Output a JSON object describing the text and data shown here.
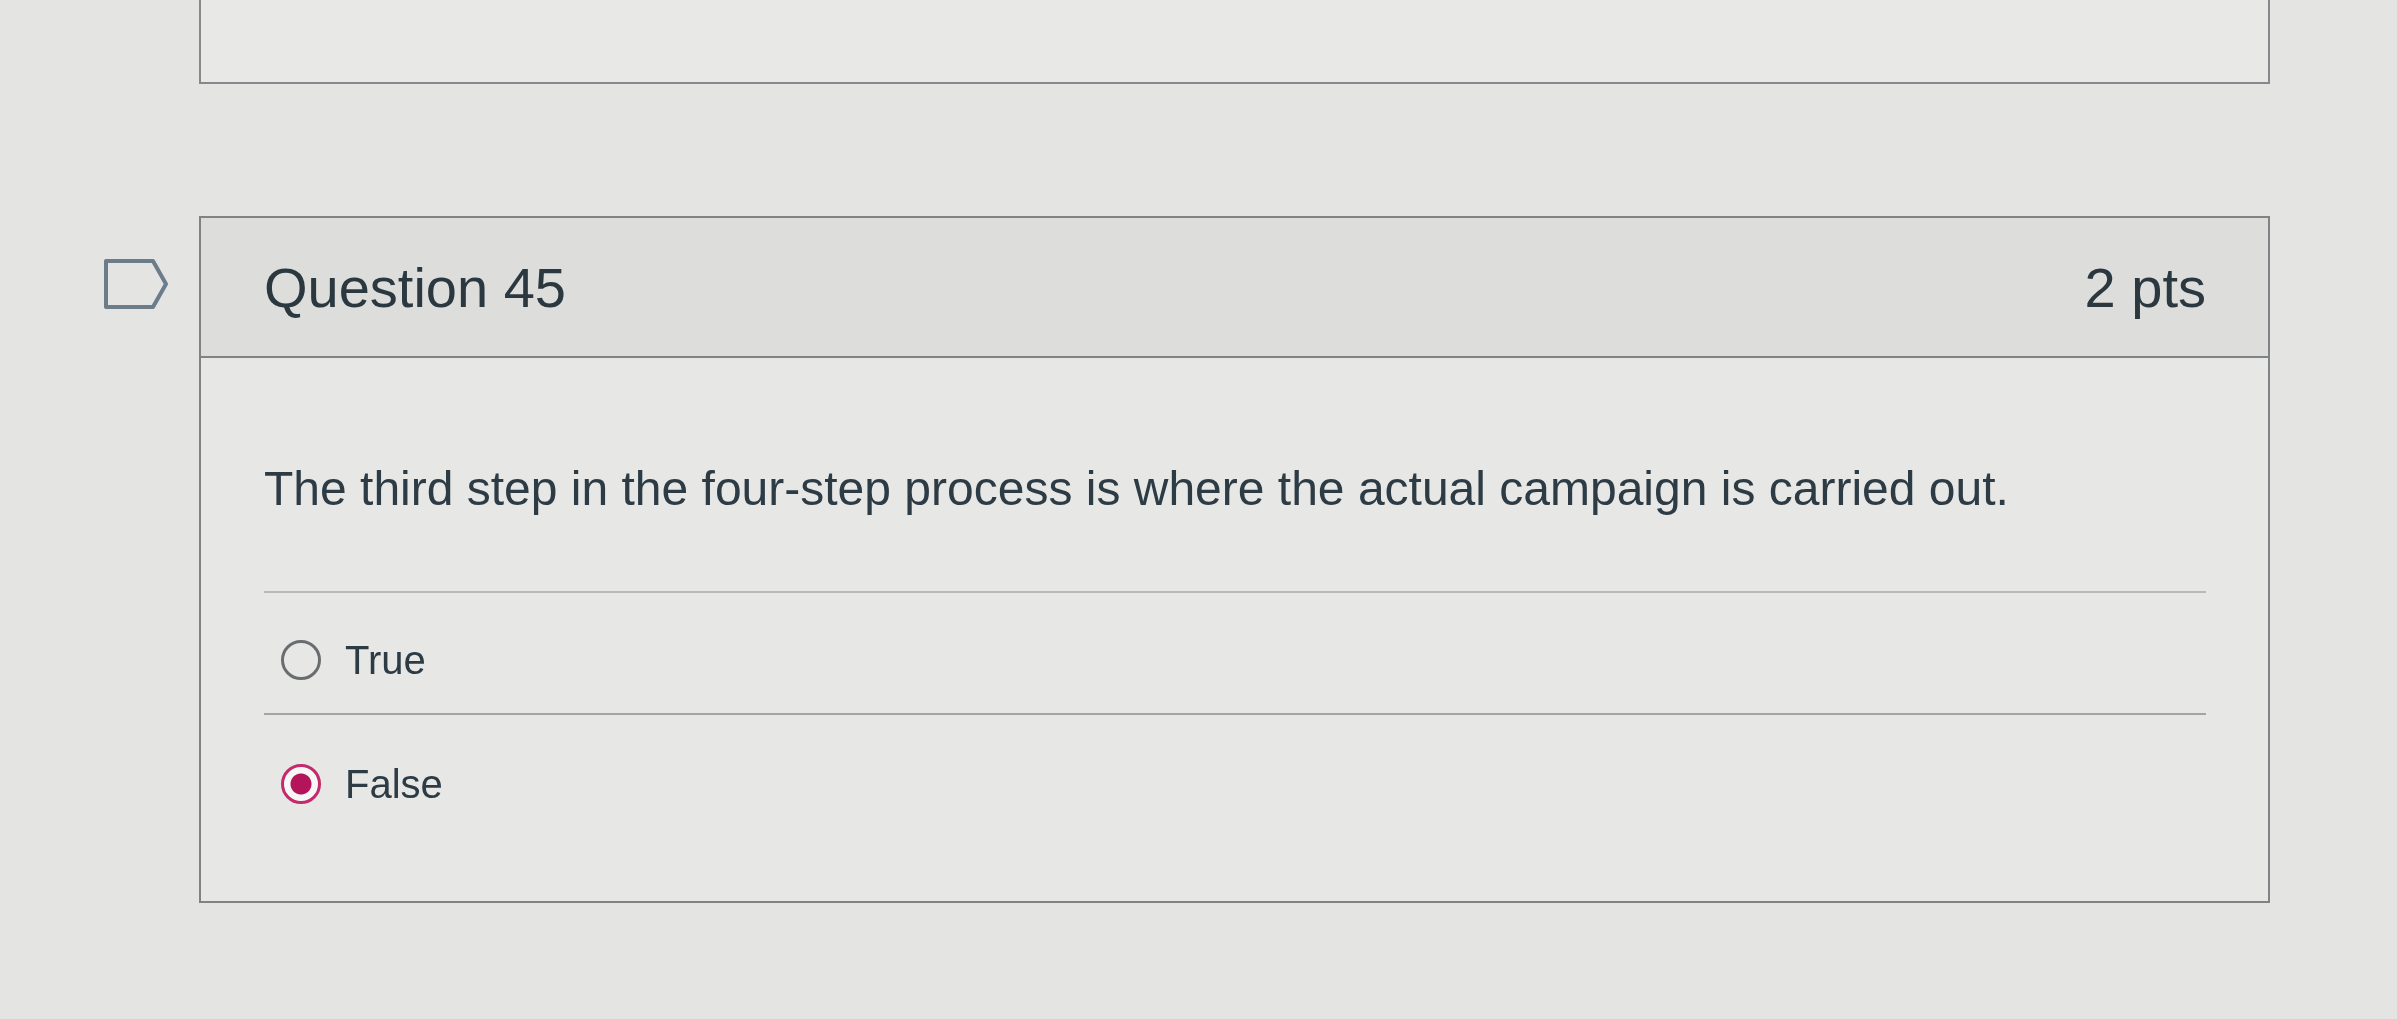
{
  "question": {
    "flagged": false,
    "title": "Question 45",
    "points": "2 pts",
    "text": "The third step in the four-step process is where the actual campaign is carried out.",
    "answers": [
      {
        "label": "True",
        "selected": false
      },
      {
        "label": "False",
        "selected": true
      }
    ]
  }
}
